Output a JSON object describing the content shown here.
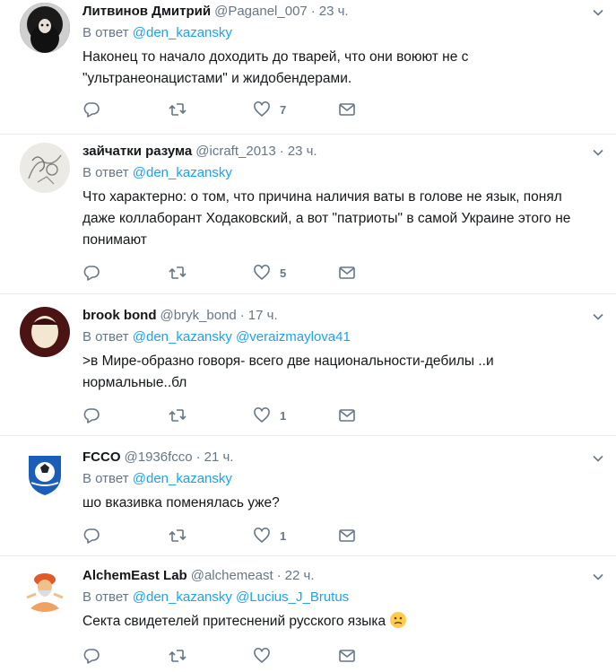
{
  "reply_prefix": "В ответ",
  "tweets": [
    {
      "name": "Литвинов Дмитрий",
      "handle": "@Paganel_007",
      "time": "23 ч.",
      "mentions": [
        "@den_kazansky"
      ],
      "text": "Наконец то начало доходить до тварей, что они воюют не с \"ультранеонацистами\" и жидобендерами.",
      "likes": "7",
      "avatar": "bearded-man-avatar"
    },
    {
      "name": "зайчатки разума",
      "handle": "@icraft_2013",
      "time": "23 ч.",
      "mentions": [
        "@den_kazansky"
      ],
      "text": "Что характерно:  о том, что причина наличия ваты в голове не язык, понял даже коллаборант Ходаковский, а вот \"патриоты\" в самой Украине этого не понимают",
      "likes": "5",
      "avatar": "sketch-avatar"
    },
    {
      "name": "brook bond",
      "handle": "@bryk_bond",
      "time": "17 ч.",
      "mentions": [
        "@den_kazansky",
        "@veraizmaylova41"
      ],
      "text": ">в Мире-образно говоря- всего две национальности-дебилы ..и нормальные..бл",
      "likes": "1",
      "avatar": "portrait-avatar"
    },
    {
      "name": "FCCO",
      "handle": "@1936fcco",
      "time": "21 ч.",
      "mentions": [
        "@den_kazansky"
      ],
      "text": "шо вказивка поменялась уже?",
      "likes": "1",
      "avatar": "football-club-logo-avatar"
    },
    {
      "name": "AlchemEast Lab",
      "handle": "@alchemeast",
      "time": "22 ч.",
      "mentions": [
        "@den_kazansky",
        "@Lucius_J_Brutus"
      ],
      "text": "Секта свидетелей притеснений русского языка",
      "likes": "",
      "avatar": "meditating-guru-avatar"
    }
  ],
  "colors": {
    "link": "#1da1f2",
    "secondary": "#657786",
    "text": "#14171a",
    "divider": "#e6ecf0"
  }
}
